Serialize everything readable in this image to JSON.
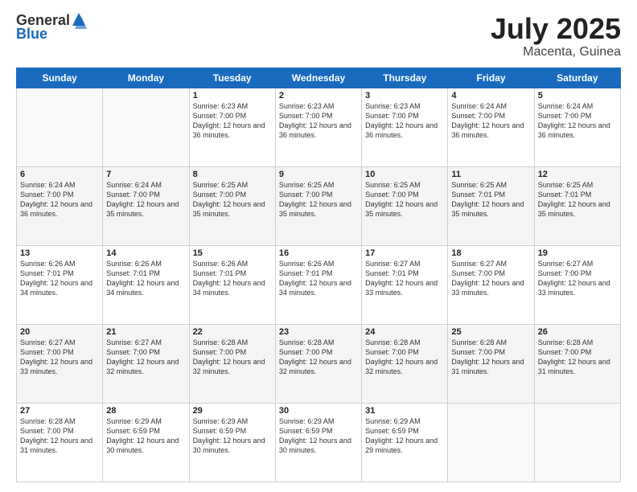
{
  "logo": {
    "general": "General",
    "blue": "Blue"
  },
  "header": {
    "month": "July 2025",
    "location": "Macenta, Guinea"
  },
  "weekdays": [
    "Sunday",
    "Monday",
    "Tuesday",
    "Wednesday",
    "Thursday",
    "Friday",
    "Saturday"
  ],
  "weeks": [
    [
      {
        "day": "",
        "info": ""
      },
      {
        "day": "",
        "info": ""
      },
      {
        "day": "1",
        "info": "Sunrise: 6:23 AM\nSunset: 7:00 PM\nDaylight: 12 hours and 36 minutes."
      },
      {
        "day": "2",
        "info": "Sunrise: 6:23 AM\nSunset: 7:00 PM\nDaylight: 12 hours and 36 minutes."
      },
      {
        "day": "3",
        "info": "Sunrise: 6:23 AM\nSunset: 7:00 PM\nDaylight: 12 hours and 36 minutes."
      },
      {
        "day": "4",
        "info": "Sunrise: 6:24 AM\nSunset: 7:00 PM\nDaylight: 12 hours and 36 minutes."
      },
      {
        "day": "5",
        "info": "Sunrise: 6:24 AM\nSunset: 7:00 PM\nDaylight: 12 hours and 36 minutes."
      }
    ],
    [
      {
        "day": "6",
        "info": "Sunrise: 6:24 AM\nSunset: 7:00 PM\nDaylight: 12 hours and 36 minutes."
      },
      {
        "day": "7",
        "info": "Sunrise: 6:24 AM\nSunset: 7:00 PM\nDaylight: 12 hours and 35 minutes."
      },
      {
        "day": "8",
        "info": "Sunrise: 6:25 AM\nSunset: 7:00 PM\nDaylight: 12 hours and 35 minutes."
      },
      {
        "day": "9",
        "info": "Sunrise: 6:25 AM\nSunset: 7:00 PM\nDaylight: 12 hours and 35 minutes."
      },
      {
        "day": "10",
        "info": "Sunrise: 6:25 AM\nSunset: 7:00 PM\nDaylight: 12 hours and 35 minutes."
      },
      {
        "day": "11",
        "info": "Sunrise: 6:25 AM\nSunset: 7:01 PM\nDaylight: 12 hours and 35 minutes."
      },
      {
        "day": "12",
        "info": "Sunrise: 6:25 AM\nSunset: 7:01 PM\nDaylight: 12 hours and 35 minutes."
      }
    ],
    [
      {
        "day": "13",
        "info": "Sunrise: 6:26 AM\nSunset: 7:01 PM\nDaylight: 12 hours and 34 minutes."
      },
      {
        "day": "14",
        "info": "Sunrise: 6:26 AM\nSunset: 7:01 PM\nDaylight: 12 hours and 34 minutes."
      },
      {
        "day": "15",
        "info": "Sunrise: 6:26 AM\nSunset: 7:01 PM\nDaylight: 12 hours and 34 minutes."
      },
      {
        "day": "16",
        "info": "Sunrise: 6:26 AM\nSunset: 7:01 PM\nDaylight: 12 hours and 34 minutes."
      },
      {
        "day": "17",
        "info": "Sunrise: 6:27 AM\nSunset: 7:01 PM\nDaylight: 12 hours and 33 minutes."
      },
      {
        "day": "18",
        "info": "Sunrise: 6:27 AM\nSunset: 7:00 PM\nDaylight: 12 hours and 33 minutes."
      },
      {
        "day": "19",
        "info": "Sunrise: 6:27 AM\nSunset: 7:00 PM\nDaylight: 12 hours and 33 minutes."
      }
    ],
    [
      {
        "day": "20",
        "info": "Sunrise: 6:27 AM\nSunset: 7:00 PM\nDaylight: 12 hours and 33 minutes."
      },
      {
        "day": "21",
        "info": "Sunrise: 6:27 AM\nSunset: 7:00 PM\nDaylight: 12 hours and 32 minutes."
      },
      {
        "day": "22",
        "info": "Sunrise: 6:28 AM\nSunset: 7:00 PM\nDaylight: 12 hours and 32 minutes."
      },
      {
        "day": "23",
        "info": "Sunrise: 6:28 AM\nSunset: 7:00 PM\nDaylight: 12 hours and 32 minutes."
      },
      {
        "day": "24",
        "info": "Sunrise: 6:28 AM\nSunset: 7:00 PM\nDaylight: 12 hours and 32 minutes."
      },
      {
        "day": "25",
        "info": "Sunrise: 6:28 AM\nSunset: 7:00 PM\nDaylight: 12 hours and 31 minutes."
      },
      {
        "day": "26",
        "info": "Sunrise: 6:28 AM\nSunset: 7:00 PM\nDaylight: 12 hours and 31 minutes."
      }
    ],
    [
      {
        "day": "27",
        "info": "Sunrise: 6:28 AM\nSunset: 7:00 PM\nDaylight: 12 hours and 31 minutes."
      },
      {
        "day": "28",
        "info": "Sunrise: 6:29 AM\nSunset: 6:59 PM\nDaylight: 12 hours and 30 minutes."
      },
      {
        "day": "29",
        "info": "Sunrise: 6:29 AM\nSunset: 6:59 PM\nDaylight: 12 hours and 30 minutes."
      },
      {
        "day": "30",
        "info": "Sunrise: 6:29 AM\nSunset: 6:59 PM\nDaylight: 12 hours and 30 minutes."
      },
      {
        "day": "31",
        "info": "Sunrise: 6:29 AM\nSunset: 6:59 PM\nDaylight: 12 hours and 29 minutes."
      },
      {
        "day": "",
        "info": ""
      },
      {
        "day": "",
        "info": ""
      }
    ]
  ]
}
